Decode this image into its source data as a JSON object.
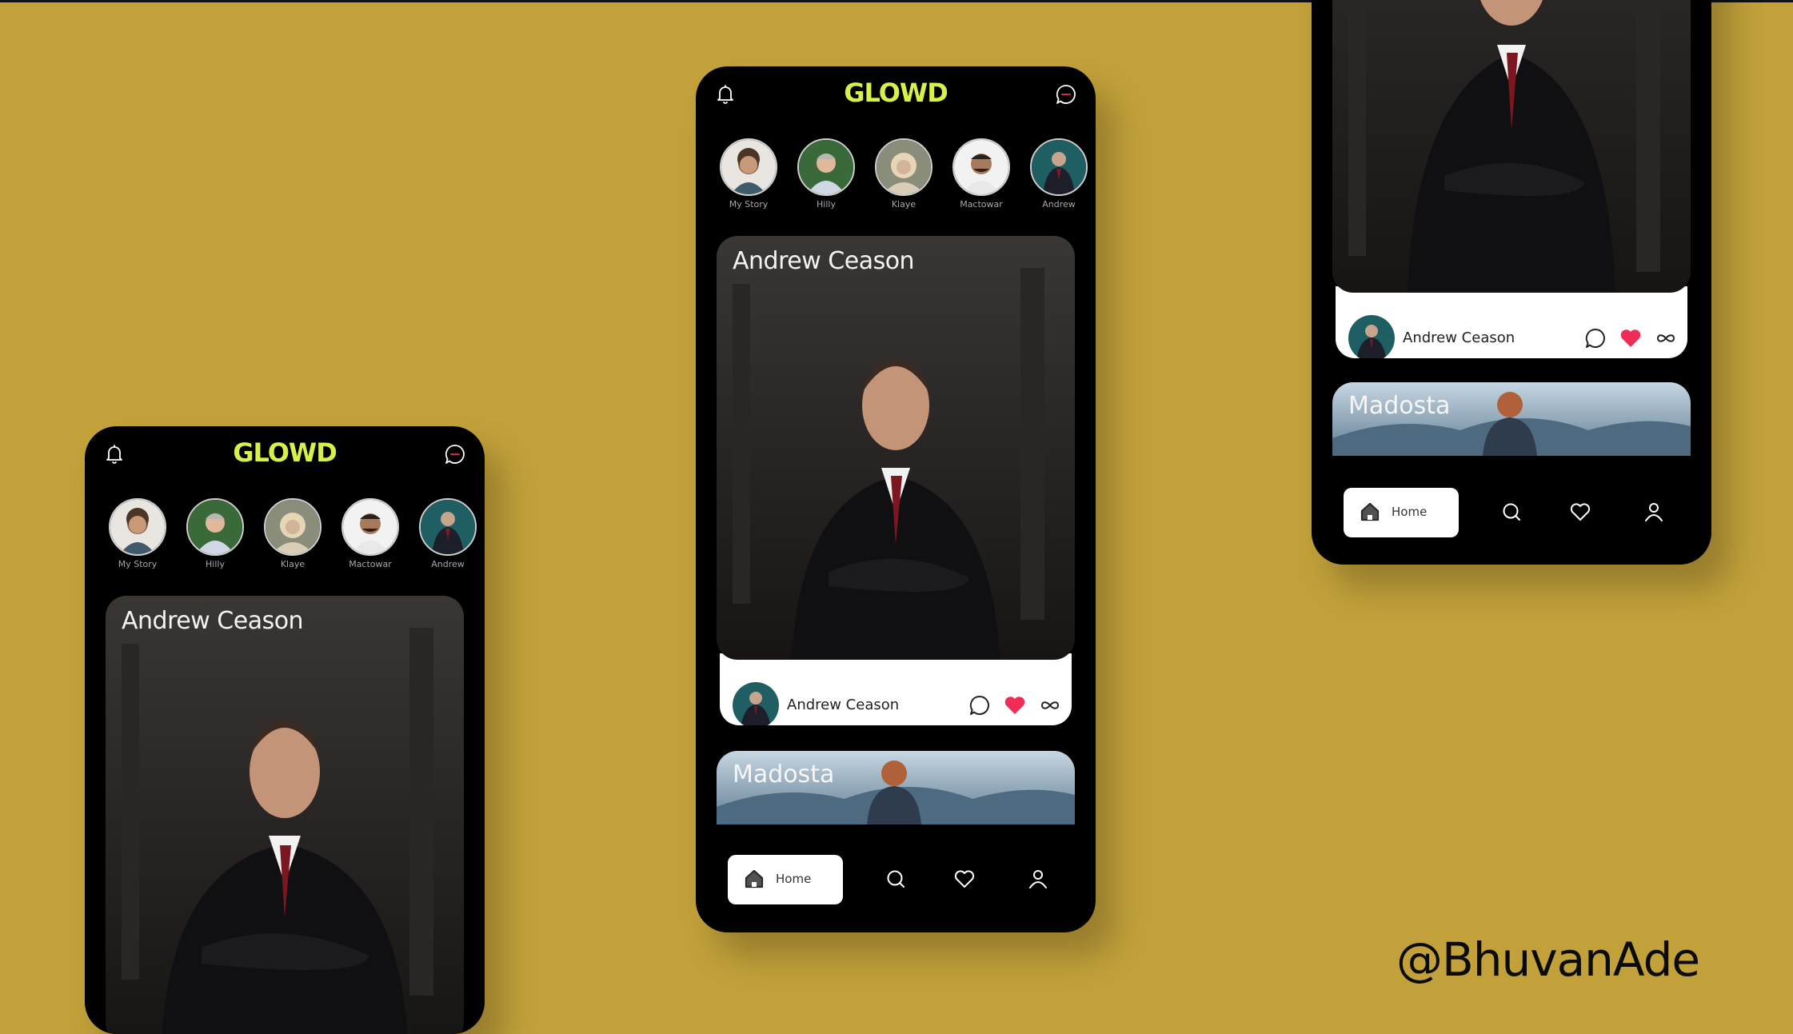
{
  "app": {
    "brand": "GLOWD"
  },
  "colors": {
    "background": "#c2a13a",
    "phone": "#000000",
    "brand": "#d9f04a",
    "like": "#ef2d56",
    "card": "#ffffff"
  },
  "stories": [
    {
      "label": "My Story"
    },
    {
      "label": "Hilly"
    },
    {
      "label": "Klaye"
    },
    {
      "label": "Mactowar"
    },
    {
      "label": "Andrew"
    }
  ],
  "post": {
    "title": "Andrew Ceason",
    "author": "Andrew Ceason"
  },
  "next_post": {
    "title": "Madosta"
  },
  "nav": {
    "home_label": "Home"
  },
  "icons": {
    "bell": "bell-icon",
    "chat": "chat-icon",
    "comment": "comment-icon",
    "like": "heart-filled-icon",
    "share": "infinity-icon",
    "home": "home-icon",
    "search": "search-icon",
    "favorites": "heart-icon",
    "profile": "user-icon"
  },
  "watermark": "@BhuvanAde"
}
